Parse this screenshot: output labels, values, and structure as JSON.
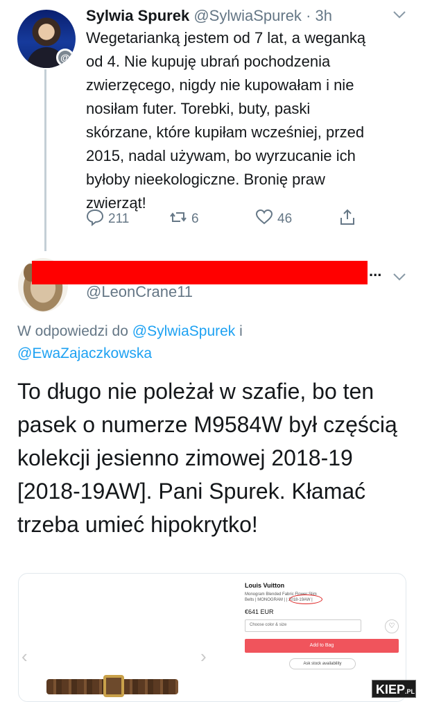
{
  "tweet1": {
    "name": "Sylwia Spurek",
    "handle": "@SylwiaSpurek",
    "time": "· 3h",
    "body": "Wegetarianką jestem od 7 lat, a weganką\nod 4. Nie kupuję ubrań pochodzenia\nzwierzęcego, nigdy nie kupowałam i nie\nnosiłam futer. Torebki, buty, paski\nskórzane, które kupiłam wcześniej, przed\n2015, nadal używam, bo wyrzucanie ich\nbyłoby nieekologiczne. Bronię praw\nzwierząt!",
    "avatar_badge": "@",
    "replies": "211",
    "retweets": "6",
    "likes": "46"
  },
  "tweet2": {
    "name_redacted": "...",
    "handle": "@LeonCrane11",
    "reply_prefix": "W odpowiedzi do",
    "reply_user1": "@SylwiaSpurek",
    "reply_and": "i",
    "reply_user2": "@EwaZajaczkowska",
    "body": "To długo nie poleżał w szafie, bo ten pasek o numerze M9584W był częścią kolekcji jesienno zimowej 2018-19 [2018-19AW]. Pani Spurek. Kłamać trzeba umieć hipokrytko!"
  },
  "embed": {
    "brand": "Louis Vuitton",
    "product_line1": "Monogram Blended Fabric Flower Slim",
    "product_line2": "Belts  | MONOGRAM |  | 2018-19AW |",
    "price": "€641 EUR",
    "select_placeholder": "Choose color & size",
    "add_button": "Add to Bag",
    "stock_button": "Ask stock availability"
  },
  "watermark": {
    "main": "KIEP",
    "suffix": ".PL"
  },
  "colors": {
    "link": "#1da1f2",
    "muted": "#657786",
    "redaction": "#ff0000",
    "add_button": "#f0545c"
  },
  "icons": [
    "reply-icon",
    "retweet-icon",
    "like-icon",
    "share-icon",
    "chevron-down-icon",
    "chevron-left-icon",
    "chevron-right-icon",
    "heart-outline-icon"
  ]
}
